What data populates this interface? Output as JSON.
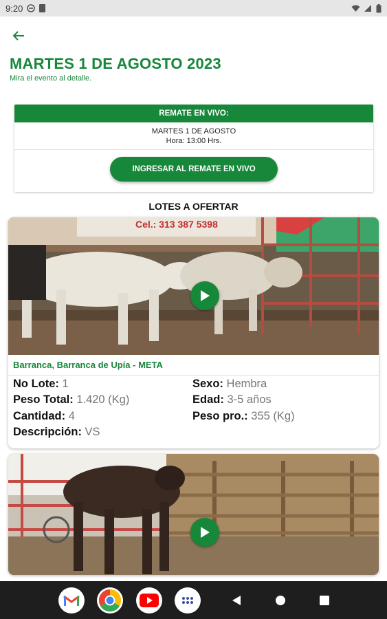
{
  "status_bar": {
    "time": "9:20"
  },
  "header": {
    "title": "MARTES 1 DE AGOSTO 2023",
    "subtitle": "Mira el evento al detalle."
  },
  "live_event": {
    "banner": "REMATE EN VIVO:",
    "date": "MARTES 1 DE AGOSTO",
    "time": "Hora: 13:00 Hrs.",
    "button_label": "INGRESAR AL REMATE EN VIVO"
  },
  "lots_section": {
    "title": "LOTES A OFERTAR"
  },
  "lots": [
    {
      "image_sign_text": "Cel.: 313 387 5398",
      "location": "Barranca, Barranca de Upía - META",
      "fields": {
        "lot_no_label": "No Lote:",
        "lot_no": "1",
        "total_weight_label": "Peso Total:",
        "total_weight": "1.420 (Kg)",
        "quantity_label": "Cantidad:",
        "quantity": "4",
        "description_label": "Descripción:",
        "description": "VS",
        "sex_label": "Sexo:",
        "sex": "Hembra",
        "age_label": "Edad:",
        "age": "3-5 años",
        "avg_weight_label": "Peso pro.:",
        "avg_weight": "355 (Kg)"
      }
    },
    {}
  ],
  "nav_bar": {
    "apps": [
      "gmail-icon",
      "chrome-icon",
      "youtube-icon",
      "app-drawer-icon"
    ],
    "buttons": [
      "back-icon",
      "home-icon",
      "recents-icon"
    ]
  },
  "colors": {
    "brand_green": "#17873a",
    "nav_bar": "#1e1e1e"
  }
}
